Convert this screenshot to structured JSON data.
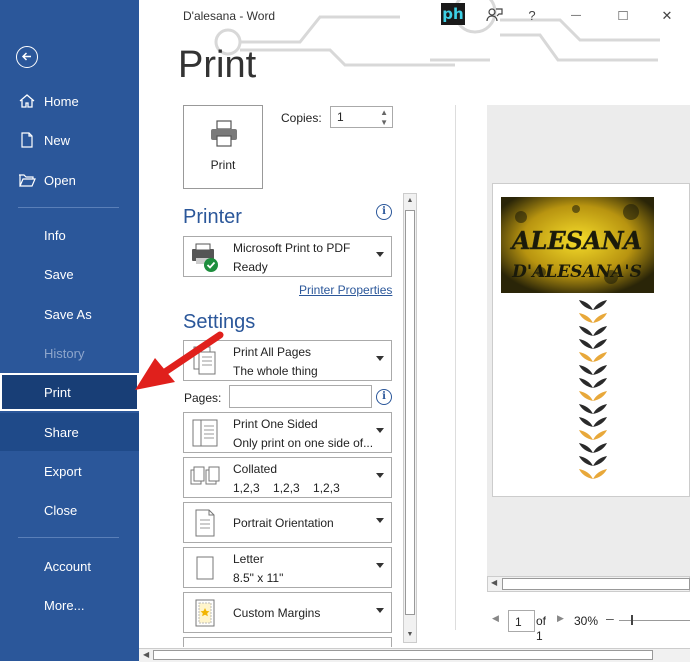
{
  "app": {
    "doc_title": "D'alesana  -  Word",
    "brand_badge": "ph"
  },
  "window_controls": {
    "help": "?",
    "minimize": "—",
    "maximize": "□",
    "close": "✕"
  },
  "sidebar": {
    "items": [
      {
        "label": "Home",
        "icon": "home-icon"
      },
      {
        "label": "New",
        "icon": "new-document-icon"
      },
      {
        "label": "Open",
        "icon": "open-folder-icon"
      },
      {
        "label": "Info"
      },
      {
        "label": "Save"
      },
      {
        "label": "Save As"
      },
      {
        "label": "History"
      },
      {
        "label": "Print"
      },
      {
        "label": "Share"
      },
      {
        "label": "Export"
      },
      {
        "label": "Close"
      },
      {
        "label": "Account"
      },
      {
        "label": "More..."
      }
    ]
  },
  "print": {
    "title": "Print",
    "print_button": "Print",
    "copies_label": "Copies:",
    "copies_value": "1",
    "printer_heading": "Printer",
    "printer_name": "Microsoft Print to PDF",
    "printer_status": "Ready",
    "printer_properties": "Printer Properties",
    "settings_heading": "Settings",
    "settings": [
      {
        "line1": "Print All Pages",
        "line2": "The whole thing"
      },
      {
        "line1": "Print One Sided",
        "line2": "Only print on one side of..."
      },
      {
        "line1": "Collated",
        "line2": "1,2,3    1,2,3    1,2,3"
      },
      {
        "line1": "Portrait Orientation"
      },
      {
        "line1": "Letter",
        "line2": "8.5\" x 11\""
      },
      {
        "line1": "Custom Margins"
      }
    ],
    "pages_label": "Pages:",
    "pages_value": ""
  },
  "preview": {
    "logo_text_1": "ALESANA",
    "logo_text_2": "D'ALESANA'S",
    "page_current": "1",
    "page_of": "of",
    "page_total": "1",
    "zoom": "30%"
  },
  "colors": {
    "sidebar": "#2b579a",
    "accent": "#2b579a",
    "arrow": "#e0201c"
  }
}
